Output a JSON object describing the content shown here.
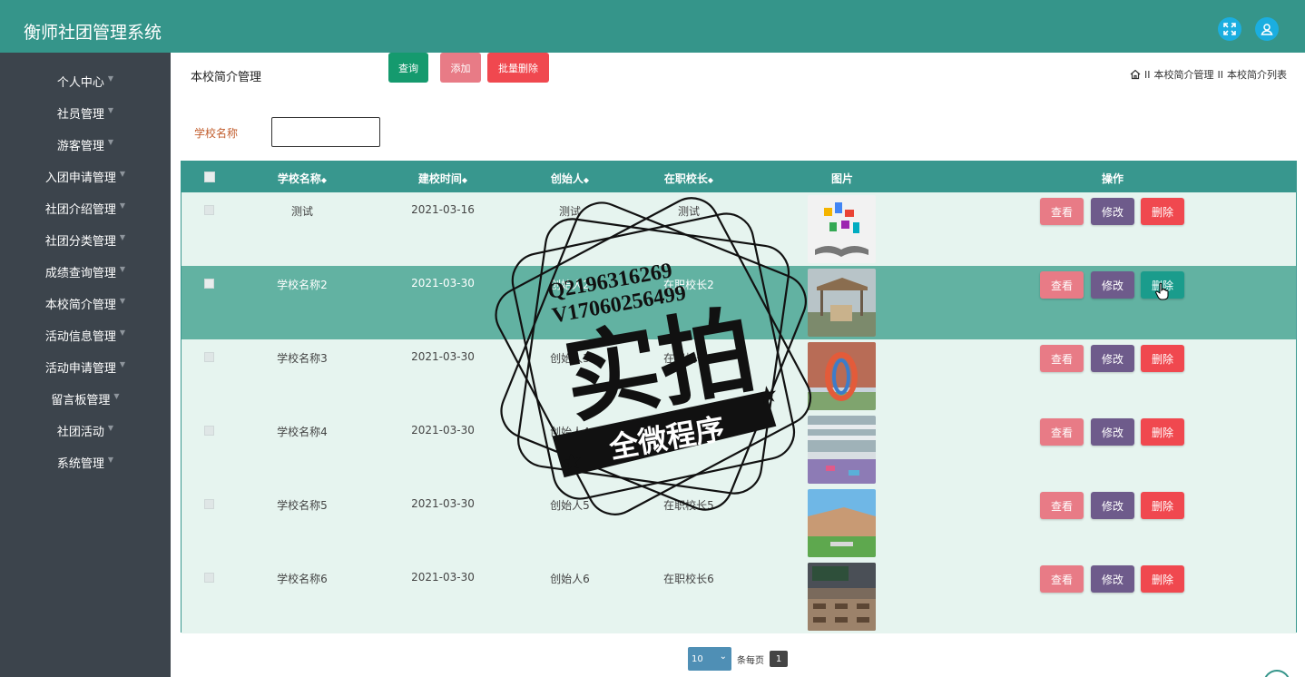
{
  "app_title": "衡师社团管理系统",
  "header": {
    "fullscreen_icon": "expand-icon",
    "user_icon": "user-icon",
    "accent": "#35958a"
  },
  "sidebar": {
    "items": [
      {
        "label": "个人中心"
      },
      {
        "label": "社员管理"
      },
      {
        "label": "游客管理"
      },
      {
        "label": "入团申请管理"
      },
      {
        "label": "社团介绍管理"
      },
      {
        "label": "社团分类管理"
      },
      {
        "label": "成绩查询管理"
      },
      {
        "label": "本校简介管理"
      },
      {
        "label": "活动信息管理"
      },
      {
        "label": "活动申请管理"
      },
      {
        "label": "留言板管理"
      },
      {
        "label": "社团活动"
      },
      {
        "label": "系统管理"
      }
    ]
  },
  "main": {
    "page_title": "本校简介管理",
    "breadcrumb": {
      "items": [
        "本校简介管理",
        "本校简介列表"
      ],
      "sep": "II"
    },
    "search": {
      "label": "学校名称",
      "value": "",
      "query_label": "查询",
      "add_label": "添加",
      "batch_delete_label": "批量删除"
    },
    "table": {
      "headers": [
        "学校名称",
        "建校时间",
        "创始人",
        "在职校长",
        "图片",
        "操作"
      ],
      "rows": [
        {
          "name": "测试",
          "date": "2021-03-16",
          "founder": "测试",
          "principal": "测试"
        },
        {
          "name": "学校名称2",
          "date": "2021-03-30",
          "founder": "创始人2",
          "principal": "在职校长2"
        },
        {
          "name": "学校名称3",
          "date": "2021-03-30",
          "founder": "创始人3",
          "principal": "在职校长3"
        },
        {
          "name": "学校名称4",
          "date": "2021-03-30",
          "founder": "创始人4",
          "principal": "在职校长4"
        },
        {
          "name": "学校名称5",
          "date": "2021-03-30",
          "founder": "创始人5",
          "principal": "在职校长5"
        },
        {
          "name": "学校名称6",
          "date": "2021-03-30",
          "founder": "创始人6",
          "principal": "在职校长6"
        }
      ],
      "actions": {
        "view": "查看",
        "edit": "修改",
        "delete": "删除"
      }
    },
    "pagination": {
      "page_size": "10",
      "per_page_label": "条每页",
      "current_page": "1"
    }
  },
  "watermark": {
    "line1": "Q2196316269",
    "line2": "V17060256499",
    "big": "实拍",
    "banner": "全微程序"
  },
  "colors": {
    "view": "#e87b86",
    "edit": "#6e5b8b",
    "delete": "#f0484f",
    "query": "#159a6e",
    "hover_delete": "#1a9c8c"
  }
}
